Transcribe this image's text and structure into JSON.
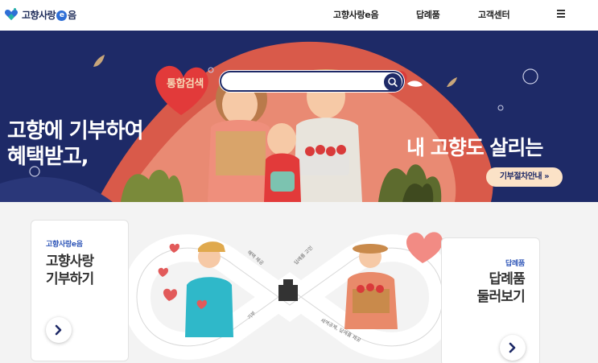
{
  "header": {
    "logo_text_1": "고향사랑",
    "logo_e": "e",
    "logo_text_2": "음",
    "nav": [
      "고향사랑e음",
      "답례품",
      "고객센터"
    ],
    "menu_icon": "hamburger-menu-icon"
  },
  "hero": {
    "search_label": "통합검색",
    "search_placeholder": "",
    "left_line_1": "고향에 기부하여",
    "left_line_2": "혜택받고,",
    "right_text": "내 고향도 살리는",
    "guide_button": "기부절차안내 »",
    "colors": {
      "background": "#1e2a67",
      "accent": "#fbe2c7"
    }
  },
  "cards": {
    "donate": {
      "small": "고향사랑e음",
      "title_1": "고향사랑",
      "title_2": "기부하기"
    },
    "gifts": {
      "small": "답례품",
      "title_1": "답례품",
      "title_2": "둘러보기"
    }
  },
  "illustration": {
    "labels": [
      "혜택 제공",
      "답례품 고민",
      "기부",
      "세액공제, 답례품 제공"
    ]
  }
}
